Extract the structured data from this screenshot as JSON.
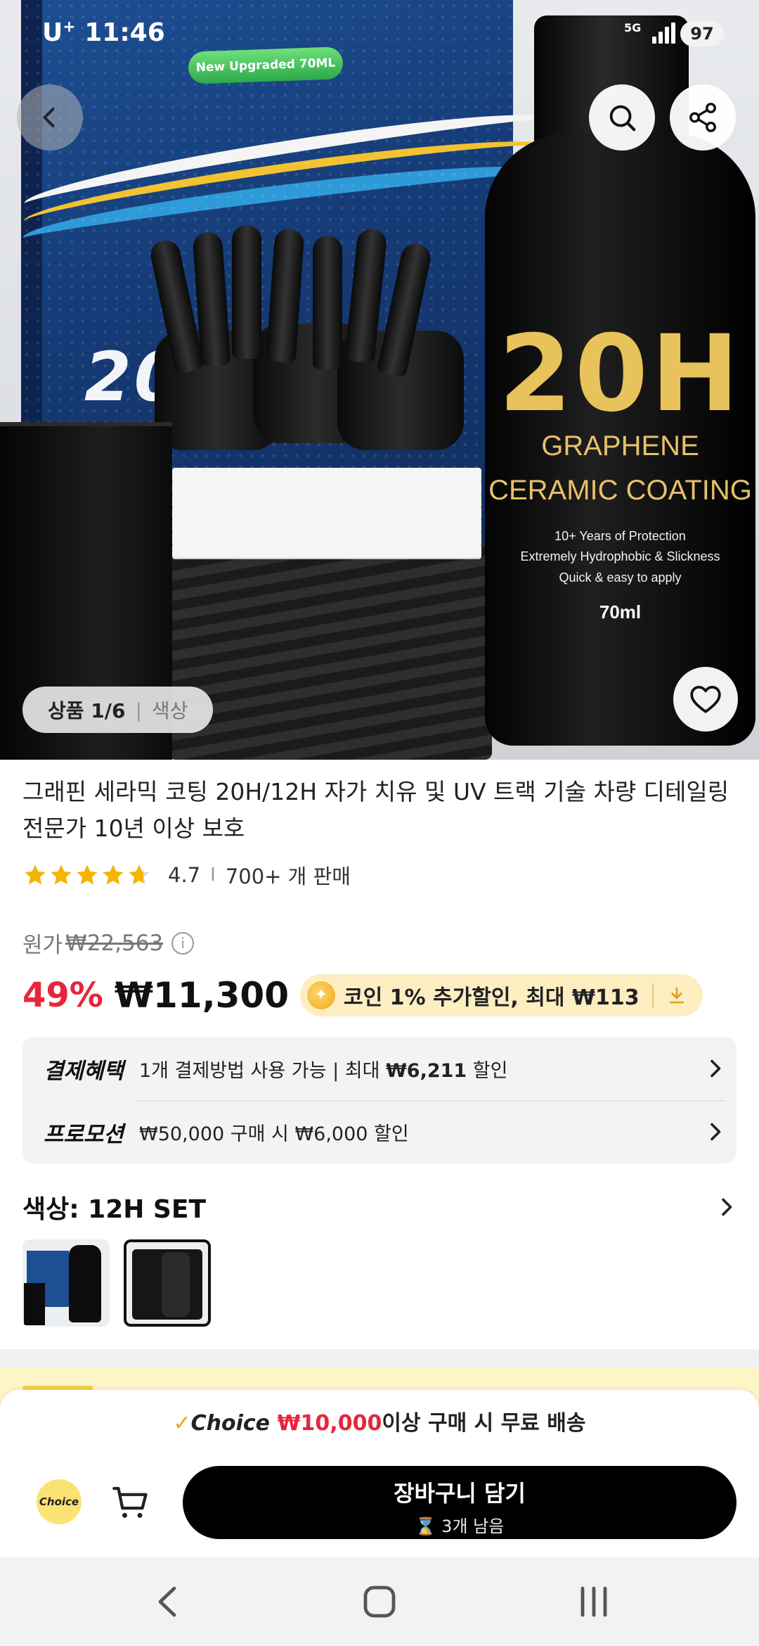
{
  "status_bar": {
    "carrier": "U",
    "carrier_sup": "+",
    "time": "11:46",
    "network": "5G",
    "battery": "97"
  },
  "hero": {
    "box_badge": "New Upgraded 70ML",
    "box_logo": "20H",
    "bottle_model": "20H",
    "bottle_line1": "GRAPHENE",
    "bottle_line2": "CERAMIC COATING",
    "bottle_tag1": "10+ Years of  Protection",
    "bottle_tag2": "Extremely Hydrophobic & Slickness",
    "bottle_tag3": "Quick & easy to apply",
    "bottle_volume": "70ml",
    "counter_current": "상품 1/6",
    "counter_sep": "|",
    "counter_color": "색상"
  },
  "product": {
    "title": "그래핀 세라믹 코팅 20H/12H 자가 치유 및 UV 트랙 기술 차량 디테일링 전문가 10년 이상 보호",
    "rating": "4.7",
    "rating_value": 4.7,
    "rating_divider": "I",
    "sold": "700+ 개 판매",
    "original_label": "원가",
    "original_price": "₩22,563",
    "discount": "49%",
    "price": "₩11,300",
    "coin_text": "코인 1% 추가할인, 최대 ₩113"
  },
  "benefits": [
    {
      "label": "결제혜택",
      "text_prefix": "1개 결제방법 사용 가능 | 최대 ",
      "text_bold": "₩6,211",
      "text_suffix": " 할인"
    },
    {
      "label": "프로모션",
      "text_prefix": "₩50,000 구매 시 ₩6,000 할인",
      "text_bold": "",
      "text_suffix": ""
    }
  ],
  "color": {
    "title": "색상: 12H SET"
  },
  "bottom_sheet": {
    "check": "✓",
    "brand": "Choice",
    "amount": "₩10,000",
    "free_shipping": "이상 구매 시 무료 배송",
    "choice_badge": "Choice",
    "add_to_cart": "장바구니 담기",
    "stock_left": "⌛ 3개 남음"
  },
  "colors": {
    "accent_red": "#e8253d",
    "coin_bg": "#fdeec2",
    "choice_yellow": "#fbe274",
    "cta_black": "#000000"
  },
  "icons": [
    "back-icon",
    "search-icon",
    "share-icon",
    "heart-icon",
    "star-icon",
    "info-icon",
    "coin-icon",
    "download-icon",
    "chevron-right-icon",
    "cart-icon",
    "nav-back-icon",
    "nav-home-icon",
    "nav-recent-icon"
  ]
}
